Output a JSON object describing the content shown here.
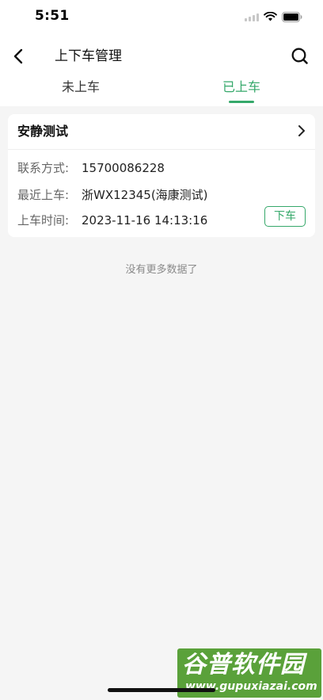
{
  "status_bar": {
    "time": "5:51"
  },
  "nav": {
    "title": "上下车管理",
    "back_icon": "chevron-left-icon",
    "search_icon": "search-icon"
  },
  "tabs": [
    {
      "label": "未上车",
      "active": false
    },
    {
      "label": "已上车",
      "active": true
    }
  ],
  "record": {
    "name": "安静测试",
    "contact_label": "联系方式:",
    "contact_value": "15700086228",
    "recent_label": "最近上车:",
    "recent_value": "浙WX12345(海康测试)",
    "time_label": "上车时间:",
    "time_value": "2023-11-16 14:13:16",
    "action_label": "下车"
  },
  "list_footer": "没有更多数据了",
  "watermark": {
    "main": "谷普软件园",
    "sub": "www.gupuxiazai.com"
  },
  "colors": {
    "accent": "#35a86a",
    "background": "#f5f5f5"
  }
}
